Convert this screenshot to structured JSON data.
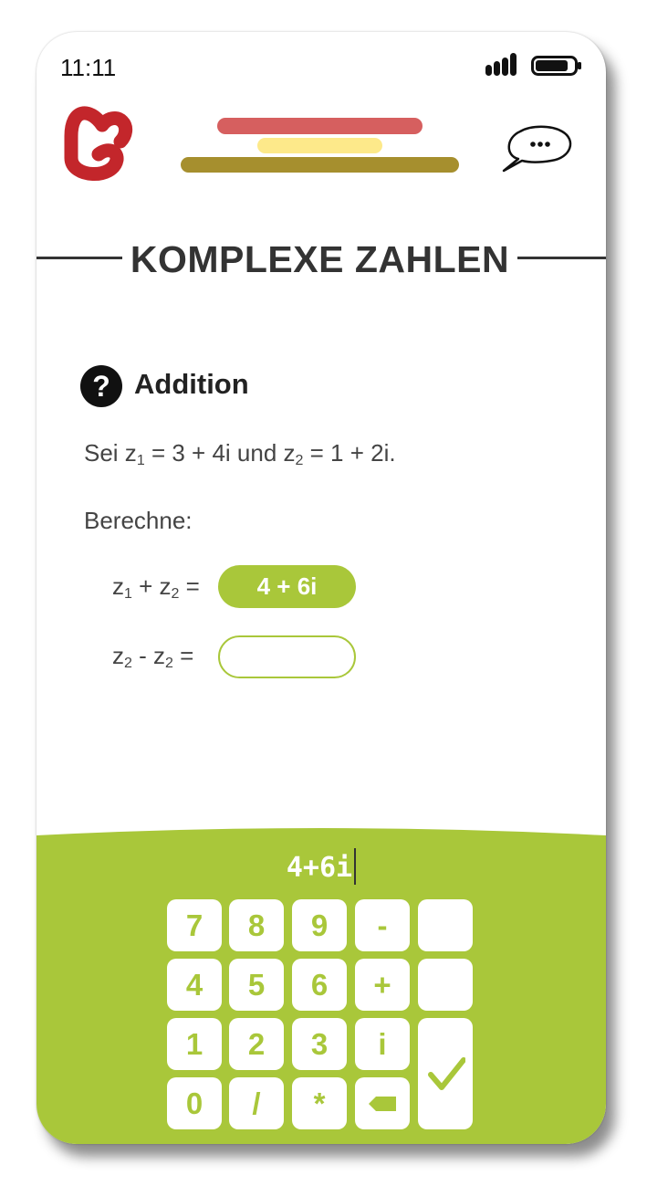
{
  "status": {
    "time": "11:11"
  },
  "colors": {
    "accent": "#a9c73a",
    "logo": "#c3262b",
    "bar_red": "#d65f5f",
    "bar_yellow": "#fde98a",
    "bar_olive": "#a68f2e"
  },
  "icons": {
    "logo": "g-logo",
    "chat": "speech-bubble-ellipsis-icon",
    "question": "question-circle-icon",
    "backspace": "backspace-icon",
    "enter": "check-icon"
  },
  "header": {
    "title": "KOMPLEXE ZAHLEN"
  },
  "task": {
    "section_title": "Addition",
    "statement": {
      "a": "Sei z",
      "sub1": "1",
      "b": " = 3 + 4i und z",
      "sub2": "2",
      "c": " = 1 + 2i."
    },
    "instruction": "Berechne:",
    "items": [
      {
        "lhs_a": "z",
        "sub1": "1",
        "op": " + z",
        "sub2": "2",
        "eq": " =",
        "answer": "4 + 6i"
      },
      {
        "lhs_a": "z",
        "sub1": "2",
        "op": " - z",
        "sub2": "2",
        "eq": " =",
        "answer": ""
      }
    ]
  },
  "keypad": {
    "input": "4+6i",
    "keys": {
      "k7": "7",
      "k8": "8",
      "k9": "9",
      "minus": "-",
      "k4": "4",
      "k5": "5",
      "k6": "6",
      "plus": "+",
      "k1": "1",
      "k2": "2",
      "k3": "3",
      "i": "i",
      "k0": "0",
      "slash": "/",
      "star": "*"
    }
  }
}
